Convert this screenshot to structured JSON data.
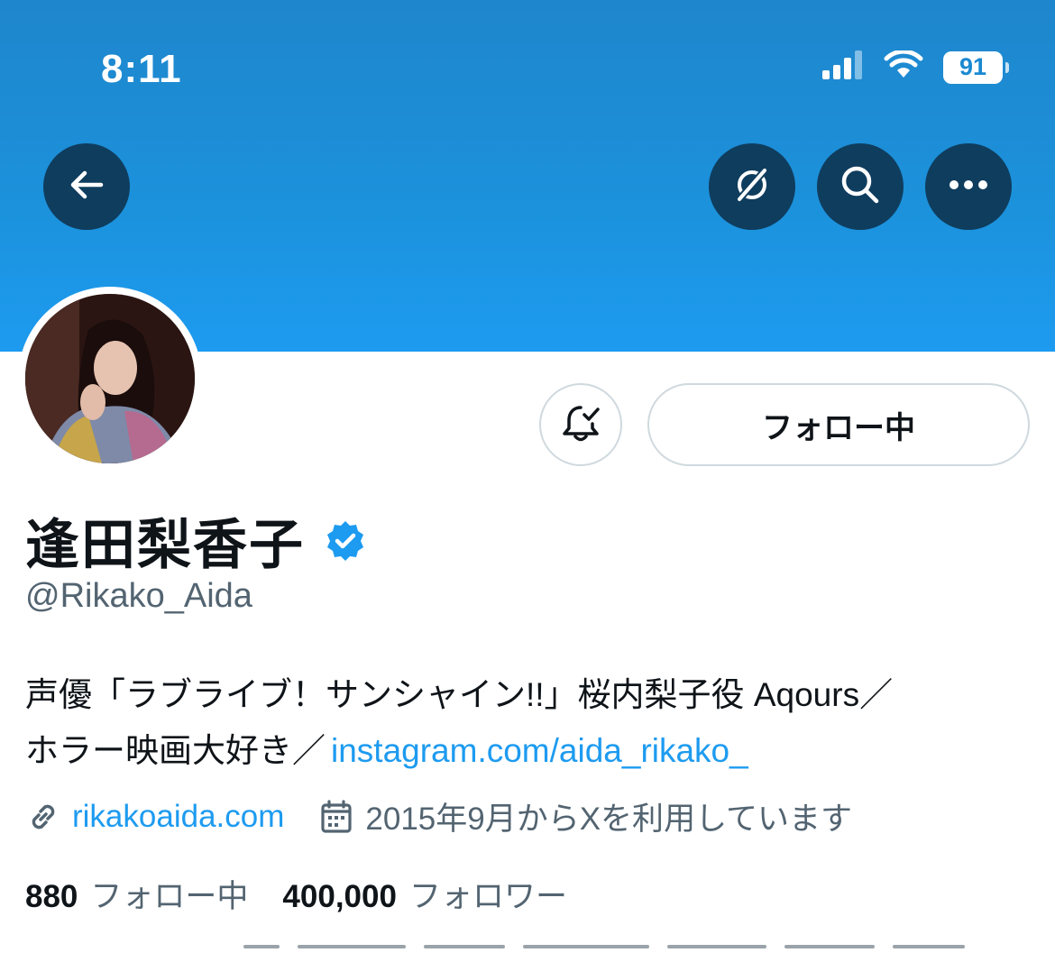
{
  "status_bar": {
    "time": "8:11",
    "battery": "91"
  },
  "header": {
    "back_icon": "arrow-left-icon",
    "actions": [
      "grok-icon",
      "search-icon",
      "more-icon"
    ]
  },
  "profile": {
    "follow_button_label": "フォロー中",
    "display_name": "逢田梨香子",
    "handle": "@Rikako_Aida",
    "bio_line1": "声優「ラブライブ！サンシャイン!!」桜内梨子役 Aqours／",
    "bio_line2_text": "ホラー映画大好き／",
    "bio_link": "instagram.com/aida_rikako_",
    "website": "rikakoaida.com",
    "joined": "2015年9月からXを利用しています",
    "following_count": "880",
    "following_label": "フォロー中",
    "followers_count": "400,000",
    "followers_label": "フォロワー"
  },
  "colors": {
    "accent": "#1d9bf0",
    "banner": "#1c92dc",
    "header_button": "#0f3d5e",
    "secondary_text": "#536471"
  }
}
